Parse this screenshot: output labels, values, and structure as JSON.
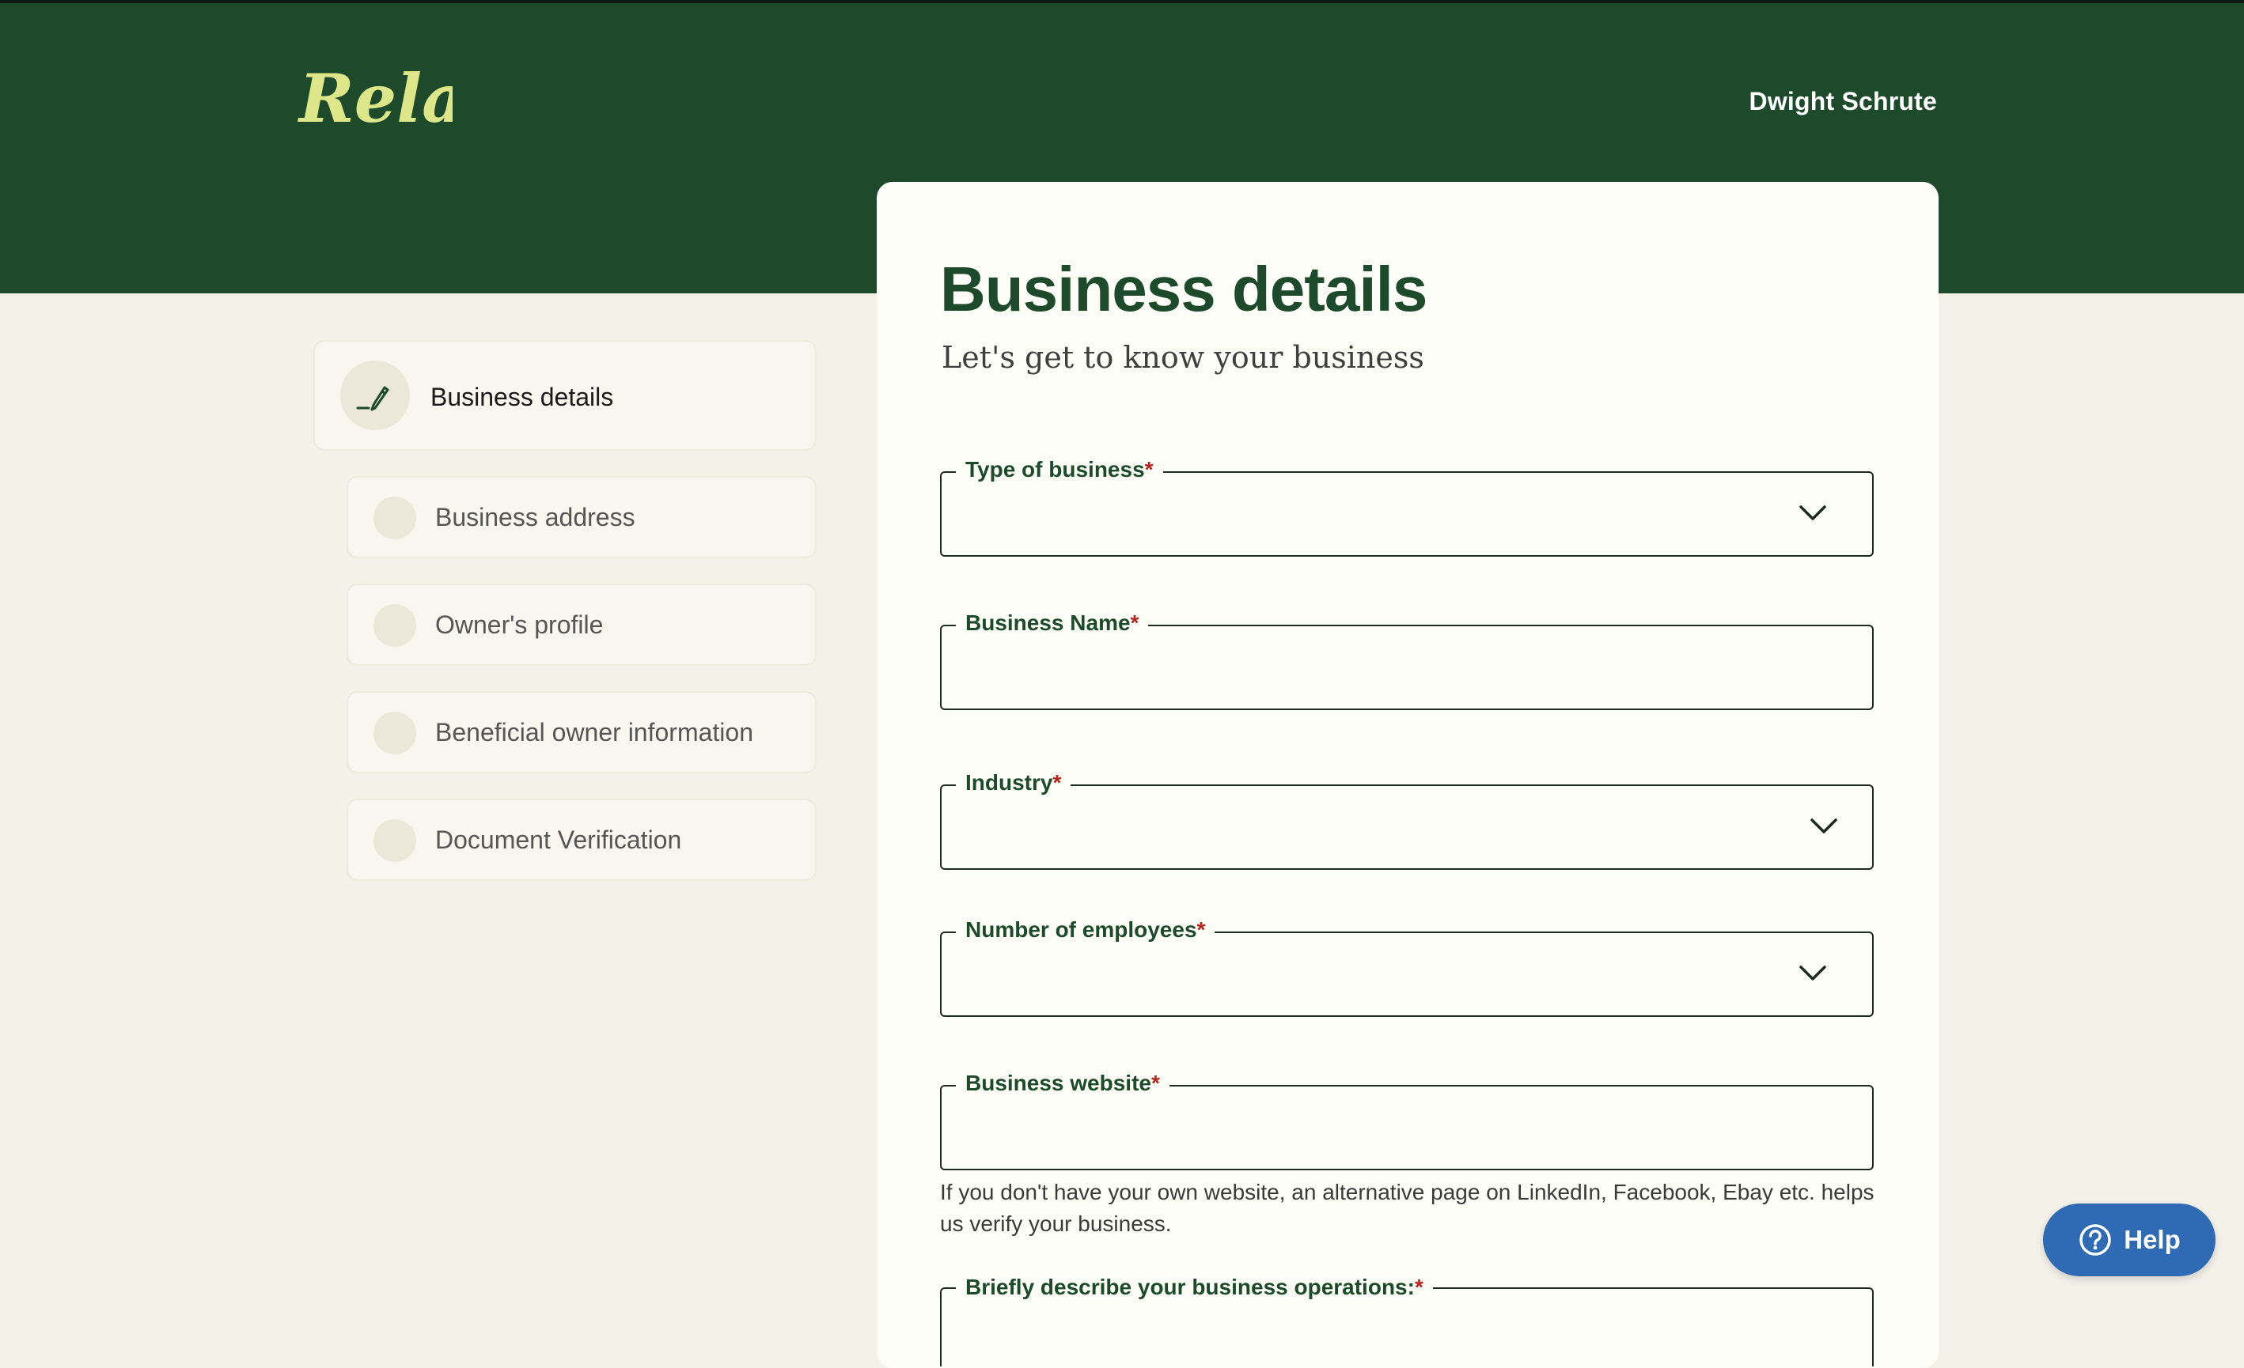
{
  "header": {
    "logo_text": "Relay",
    "user_name": "Dwight Schrute"
  },
  "sidebar": {
    "steps": [
      {
        "label": "Business details",
        "state": "active"
      },
      {
        "label": "Business address",
        "state": "pending"
      },
      {
        "label": "Owner's profile",
        "state": "pending"
      },
      {
        "label": "Beneficial owner information",
        "state": "pending"
      },
      {
        "label": "Document Verification",
        "state": "pending"
      }
    ]
  },
  "form": {
    "title": "Business details",
    "subtitle": "Let's get to know your business",
    "fields": [
      {
        "label": "Type of business",
        "type": "select",
        "value": ""
      },
      {
        "label": "Business Name",
        "type": "text",
        "value": ""
      },
      {
        "label": "Industry",
        "type": "select",
        "value": ""
      },
      {
        "label": "Number of employees",
        "type": "select",
        "value": ""
      },
      {
        "label": "Business website",
        "type": "text",
        "value": ""
      },
      {
        "label": "Briefly describe your business operations:",
        "type": "textarea",
        "value": ""
      }
    ],
    "required_marker": "*",
    "website_helper": "If you don't have your own website, an alternative page on LinkedIn, Facebook, Ebay etc. helps us verify your business."
  },
  "help": {
    "label": "Help",
    "icon": "question-circle-icon"
  },
  "colors": {
    "brand_green": "#1c4a2a",
    "logo_yellow": "#dde688",
    "background": "#f3f1e8",
    "required_red": "#b3261e",
    "help_blue": "#2f6bb5"
  }
}
